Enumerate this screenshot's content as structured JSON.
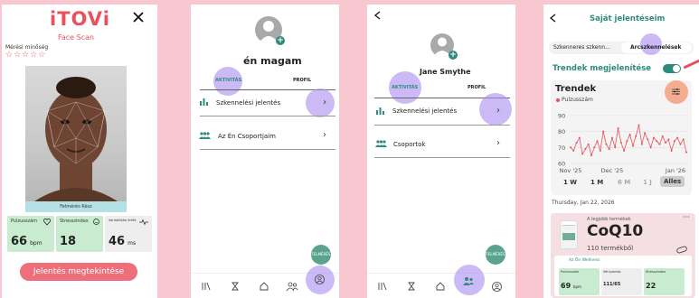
{
  "panel1": {
    "logo": "iTOVi",
    "logo_sub": "Face Scan",
    "rating_label": "Mérési minőség",
    "stars": "☆☆☆☆☆",
    "face_status": "Felmérés Kész",
    "metrics": [
      {
        "label": "Pulzusszám",
        "value": "66",
        "unit": "bpm",
        "color": "#c9ecd0",
        "icon": "heart-icon"
      },
      {
        "label": "Stresszindex",
        "value": "18",
        "unit": "",
        "color": "#c9ecd0",
        "icon": "smile-icon"
      },
      {
        "label": "Variabilitási érték",
        "value": "46",
        "unit": "ms",
        "color": "#eeeeee",
        "icon": "pulse-icon"
      }
    ],
    "cta_label": "Jelentés megtekintése"
  },
  "panel2": {
    "name": "én magam",
    "tabs": [
      "AKTIVITÁS",
      "PROFIL"
    ],
    "items": [
      "Szkennelési jelentés",
      "Az Én Csoportjaim"
    ],
    "fab_label": "FELMÉRÉS"
  },
  "panel3": {
    "name": "Jane Smythe",
    "tabs": [
      "AKTIVITÁS",
      "PROFIL"
    ],
    "items": [
      "Szkennelési jelentés",
      "Csoportok"
    ],
    "fab_label": "FELMÉRÉS"
  },
  "panel4": {
    "title": "Saját jelentéseim",
    "segments": [
      "Szkenneres szkenn...",
      "Arcszkennelések"
    ],
    "trend_toggle_label": "Trendek megjelenítése",
    "card_title": "Trendek",
    "legend": "Pulzusszám",
    "y_ticks": [
      "90",
      "80",
      "70",
      "60"
    ],
    "x_ticks": [
      "Nov '25",
      "Dec '25",
      "Jan '26"
    ],
    "ranges": [
      "1 W",
      "1 M",
      "6 M",
      "1 J",
      "Alles"
    ],
    "date": "Thursday, Jan 22, 2026",
    "product_kicker": "A legjobb termékek",
    "product_name": "CoQ10",
    "product_count": "110 termékből",
    "wellness_label": "Az Ön Wellness",
    "mini": [
      {
        "label": "Pulzusszám",
        "value": "69",
        "unit": "bpm"
      },
      {
        "label": "Vérnyomás",
        "value": "",
        "unit": "111/65"
      },
      {
        "label": "Stresszindex",
        "value": "22",
        "unit": ""
      }
    ],
    "chart_data": {
      "type": "line",
      "title": "Trendek",
      "series": [
        {
          "name": "Pulzusszám",
          "color": "#e9515e",
          "values": [
            70,
            68,
            73,
            76,
            66,
            69,
            72,
            65,
            70,
            74,
            68,
            80,
            72,
            69,
            76,
            70,
            82,
            73,
            68,
            74,
            78,
            71,
            77,
            84,
            72,
            79,
            75,
            70,
            76,
            74,
            72,
            77,
            73,
            75,
            68,
            74,
            76,
            72,
            75,
            67
          ]
        }
      ],
      "x": [
        "Nov '25",
        "",
        "",
        "",
        "",
        "",
        "",
        "",
        "",
        "",
        "",
        "",
        "",
        "",
        "Dec '25",
        "",
        "",
        "",
        "",
        "",
        "",
        "",
        "",
        "",
        "",
        "",
        "",
        "",
        "",
        "",
        "",
        "",
        "",
        "",
        "",
        "",
        "",
        "",
        "Jan '26",
        ""
      ],
      "ylim": [
        60,
        95
      ]
    }
  }
}
